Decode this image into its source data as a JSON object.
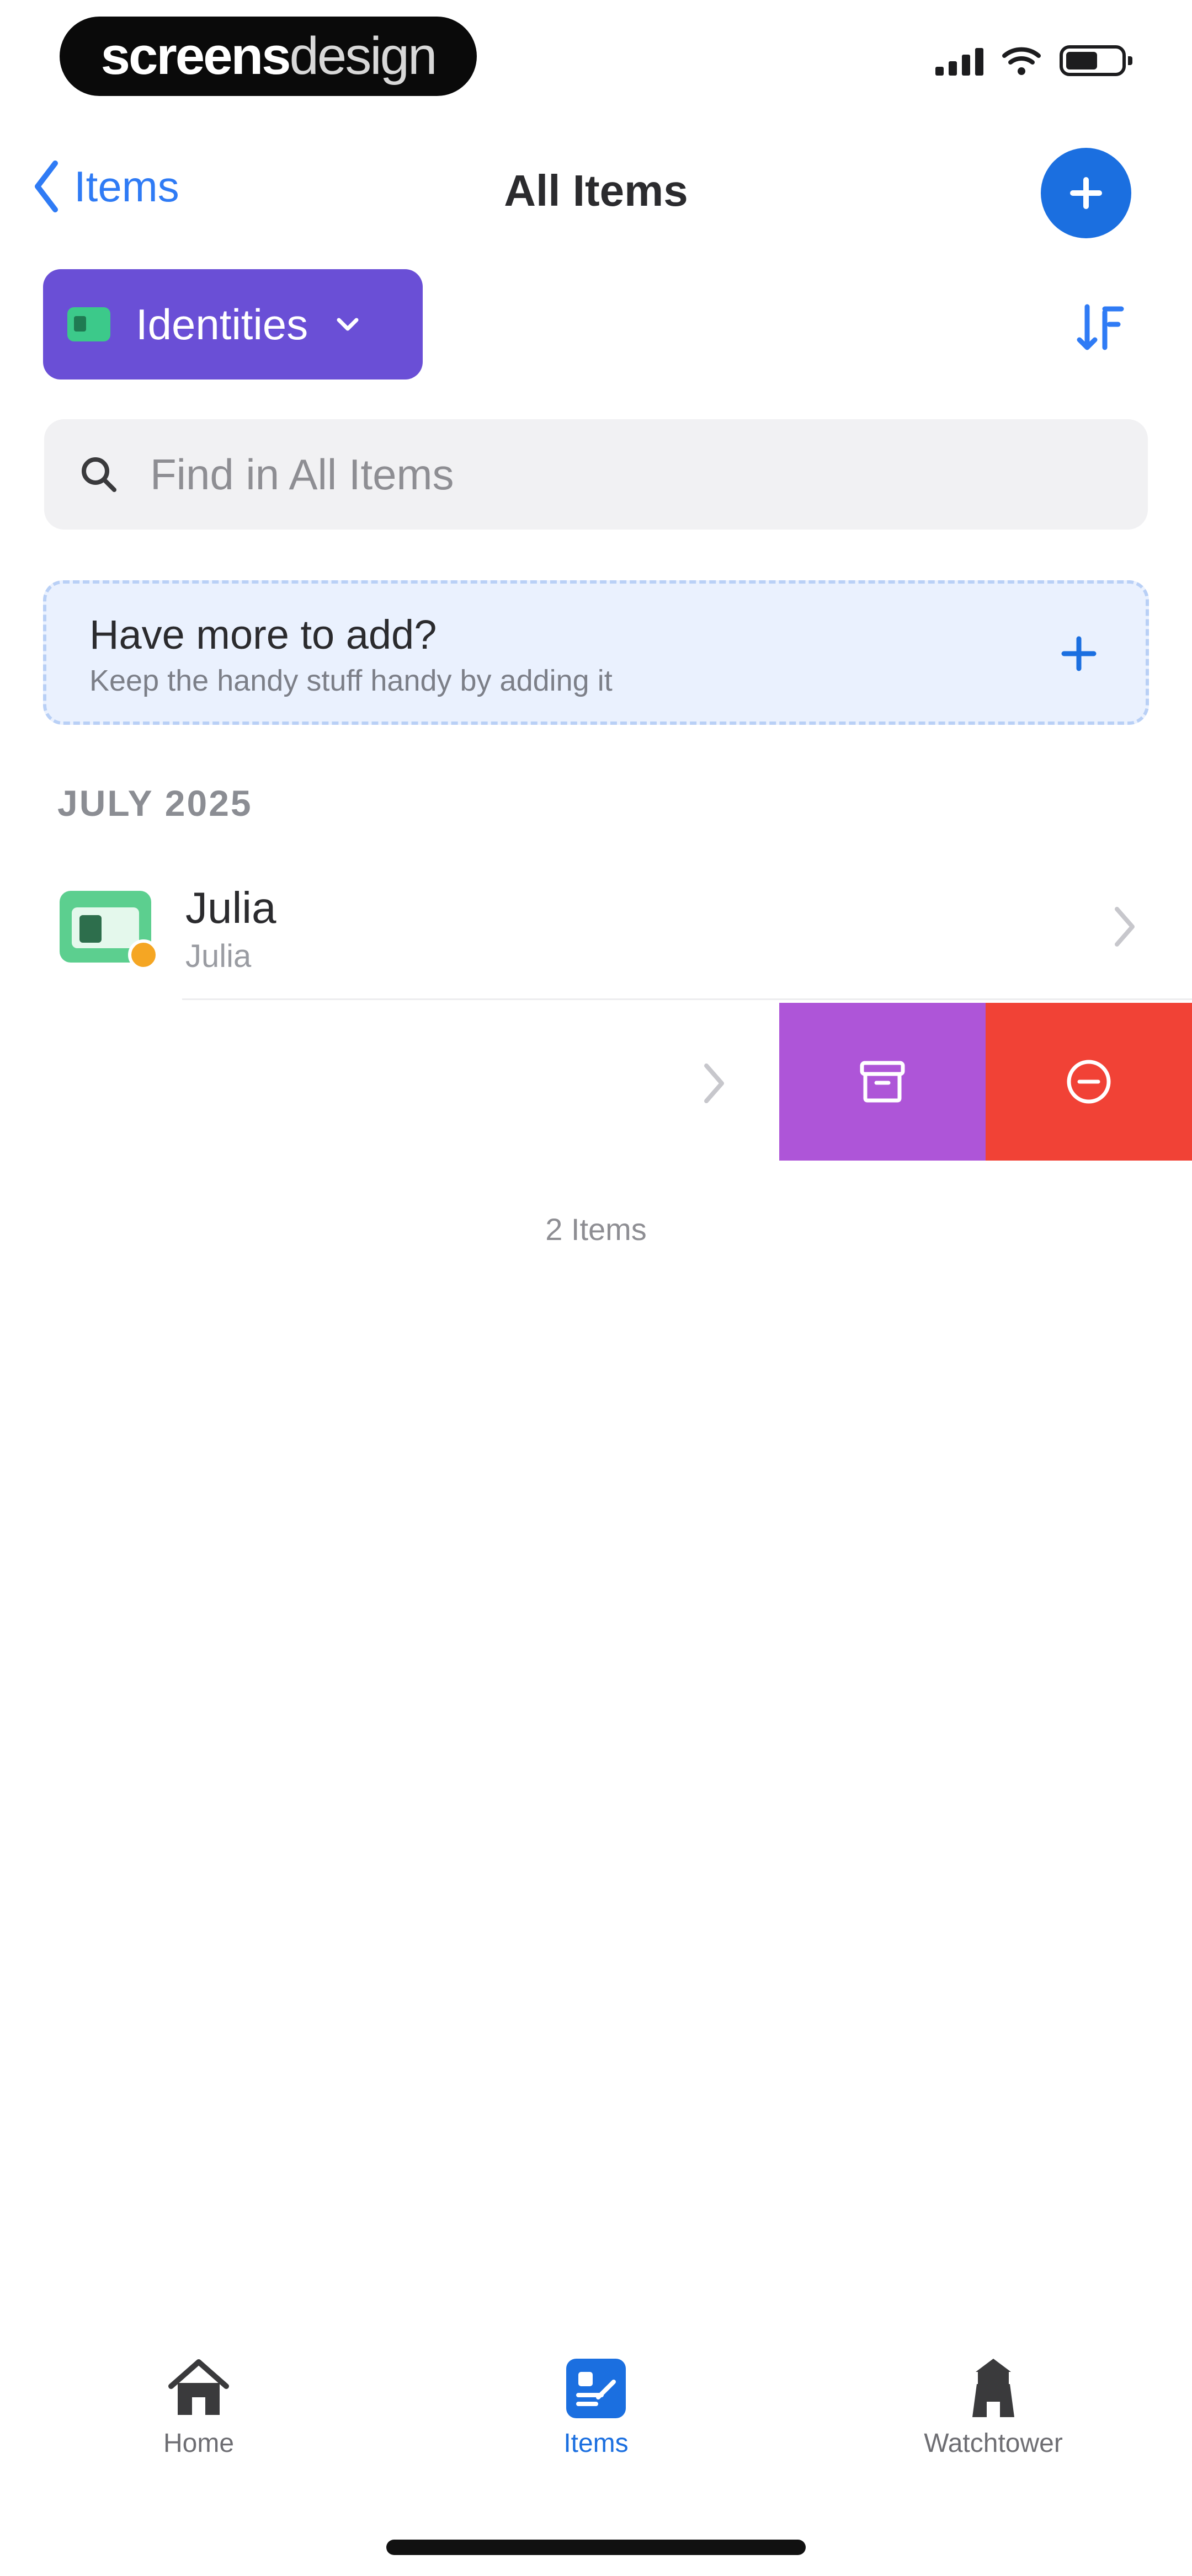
{
  "status_bar": {
    "brand_bold": "screens",
    "brand_light": "design"
  },
  "header": {
    "back_label": "Items",
    "title": "All Items"
  },
  "filter": {
    "selected": "Identities",
    "icon": "identity-card-icon"
  },
  "search": {
    "placeholder": "Find in All Items",
    "value": ""
  },
  "promo": {
    "title": "Have more to add?",
    "subtitle": "Keep the handy stuff handy by adding it"
  },
  "section": {
    "heading": "JULY 2025"
  },
  "items": [
    {
      "title": "Julia",
      "subtitle": "Julia"
    }
  ],
  "swipe_actions": {
    "archive_icon": "archive-icon",
    "delete_icon": "delete-icon"
  },
  "footer": {
    "count": "2 Items"
  },
  "tab_bar": {
    "tabs": [
      {
        "label": "Home",
        "icon": "home-icon",
        "active": false
      },
      {
        "label": "Items",
        "icon": "items-icon",
        "active": true
      },
      {
        "label": "Watchtower",
        "icon": "watchtower-icon",
        "active": false
      }
    ]
  },
  "colors": {
    "accent": "#1b6fe0",
    "filter": "#6a4fd6",
    "archive": "#ae55d8",
    "delete": "#f14236"
  }
}
